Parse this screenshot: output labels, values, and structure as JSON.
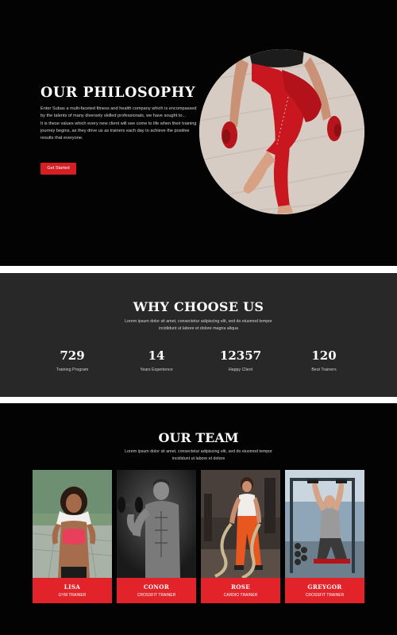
{
  "philosophy": {
    "title": "OUR PHILOSOPHY",
    "paragraph1": "Enter Subas a multi-faceted fitness and health company which is encompassed by the talents of many diversely skilled professionals, we have sought to...",
    "paragraph2": "It is these values which every new client will see come to life when their training journey begins, as they drive us as trainers each day to achieve the positive results that everyone.",
    "button_label": "Get Started"
  },
  "why": {
    "title": "WHY CHOOSE US",
    "subtitle": "Lorem ipsum dolor sit amet, consectetur adipiscing elit, sed do eiusmod tempor incididunt ut labore et dolore magna aliqua",
    "stats": [
      {
        "value": "729",
        "label": "Training Program"
      },
      {
        "value": "14",
        "label": "Years Experience"
      },
      {
        "value": "12357",
        "label": "Happy Client"
      },
      {
        "value": "120",
        "label": "Best Trainers"
      }
    ]
  },
  "team": {
    "title": "OUR TEAM",
    "subtitle": "Lorem ipsum dolor sit amet, consectetur adipiscing elit, sed do eiusmod tempor incididunt ut labore et dolore",
    "members": [
      {
        "name": "LISA",
        "role": "GYM TRAINER"
      },
      {
        "name": "CONOR",
        "role": "CROSSFIT TRAINER"
      },
      {
        "name": "ROSE",
        "role": "CARDIO TRAINER"
      },
      {
        "name": "GREYGOR",
        "role": "CROSSFIT TRAINER"
      }
    ]
  },
  "colors": {
    "accent": "#e3232a",
    "dark_bg": "#030303",
    "stats_bg": "#282828"
  }
}
